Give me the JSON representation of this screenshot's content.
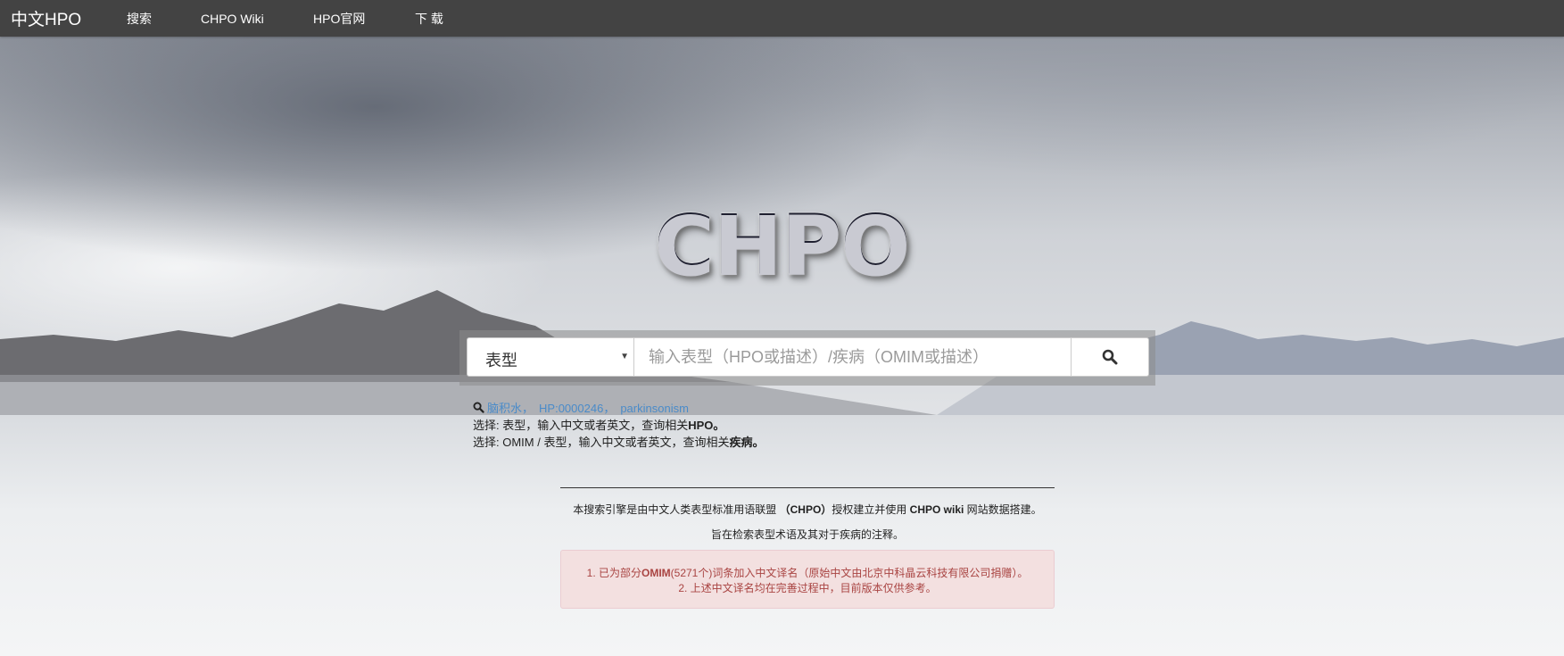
{
  "navbar": {
    "brand": "中文HPO",
    "links": [
      "搜索",
      "CHPO Wiki",
      "HPO官网",
      "下 载"
    ]
  },
  "logo": "CHPO",
  "search": {
    "type_selected": "表型",
    "placeholder": "输入表型（HPO或描述）/疾病（OMIM或描述）"
  },
  "hints": {
    "examples": [
      "脑积水",
      "HP:0000246",
      "parkinsonism"
    ],
    "line1_prefix": "选择: 表型，输入中文或者英文，查询相关",
    "line1_bold": "HPO。",
    "line2_prefix": "选择: OMIM / 表型，输入中文或者英文，查询相关",
    "line2_bold": "疾病。"
  },
  "info": {
    "line1_pre": "本搜索引擎是由中文人类表型标准用语联盟 ",
    "line1_bold1": "（CHPO）",
    "line1_mid": "授权建立并使用 ",
    "line1_bold2": "CHPO wiki",
    "line1_post": " 网站数据搭建。",
    "line2": "旨在检索表型术语及其对于疾病的注释。"
  },
  "alert": {
    "line1_pre": "1. 已为部分",
    "line1_bold": "OMIM",
    "line1_post": "(5271个)词条加入中文译名（原始中文由北京中科晶云科技有限公司捐赠）。",
    "line2": "2. 上述中文译名均在完善过程中，目前版本仅供参考。"
  },
  "colors": {
    "navbar": "#434343",
    "link": "#4a8bc9",
    "alert_bg": "#f2dede",
    "alert_text": "#a94442"
  }
}
